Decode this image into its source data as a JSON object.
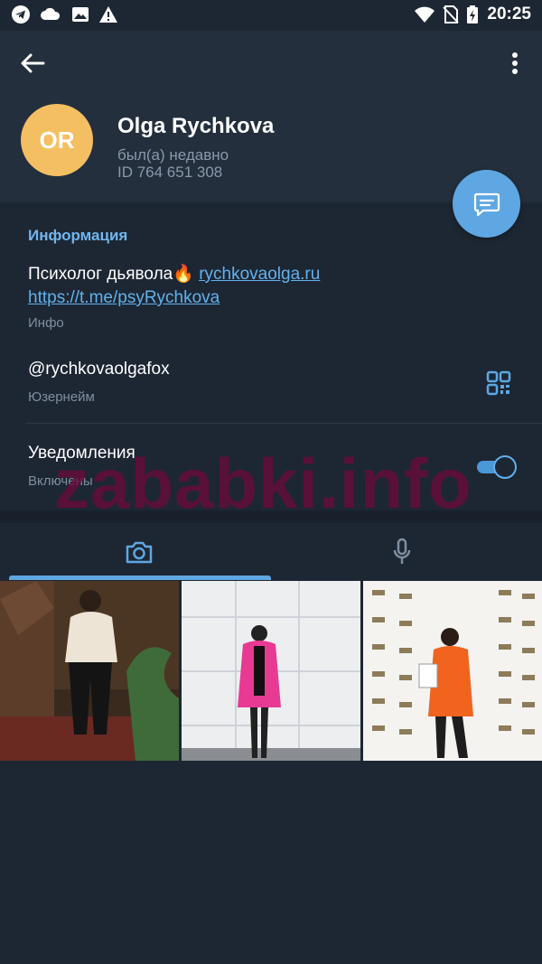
{
  "status_bar": {
    "time": "20:25",
    "icons": [
      "telegram-icon",
      "cloud-icon",
      "image-icon",
      "warning-icon",
      "wifi-icon",
      "no-sim-icon",
      "battery-charging-icon"
    ]
  },
  "profile": {
    "avatar_initials": "OR",
    "avatar_color": "#f4bf62",
    "name": "Olga Rychkova",
    "status": "был(а) недавно",
    "id_line": "ID 764 651 308"
  },
  "info": {
    "section_title": "Информация",
    "bio_text": "Психолог дьявола🔥 ",
    "bio_link1": "rychkovaolga.ru",
    "bio_link2": "https://t.me/psyRychkova",
    "bio_label": "Инфо",
    "username": "@rychkovaolgafox",
    "username_label": "Юзернейм",
    "notifications_title": "Уведомления",
    "notifications_label": "Включены",
    "notifications_enabled": true
  },
  "tabs": [
    {
      "name": "photos",
      "icon": "camera-icon",
      "active": true
    },
    {
      "name": "voice",
      "icon": "microphone-icon",
      "active": false
    }
  ],
  "media": [
    {
      "id": "photo-1",
      "desc": "woman in white sweater"
    },
    {
      "id": "photo-2",
      "desc": "woman in pink coat"
    },
    {
      "id": "photo-3",
      "desc": "woman in orange jacket with certificate"
    }
  ],
  "watermark": "zababki.info",
  "colors": {
    "background": "#1d2733",
    "header": "#232f3c",
    "accent": "#5ea7e3",
    "link": "#62b1ec"
  }
}
